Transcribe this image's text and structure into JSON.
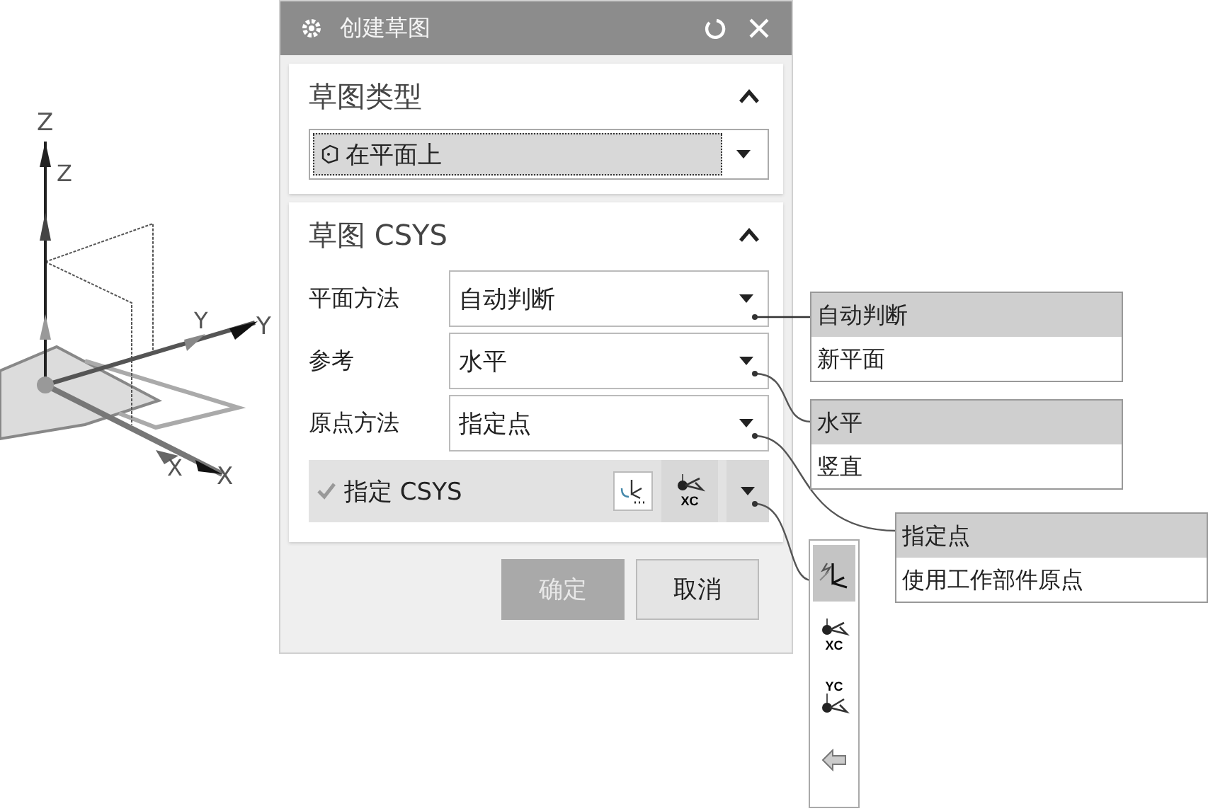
{
  "axes_drawing": {
    "labels": [
      {
        "text": "Z"
      },
      {
        "text": "Z"
      },
      {
        "text": "Y"
      },
      {
        "text": "Y"
      },
      {
        "text": "X"
      },
      {
        "text": "X"
      }
    ]
  },
  "dialog": {
    "title": "创建草图",
    "sketch_type": {
      "title": "草图类型",
      "expanded": true,
      "value": "在平面上"
    },
    "sketch_csys": {
      "title": "草图 CSYS",
      "expanded": true,
      "fields": [
        {
          "label": "平面方法",
          "value": "自动判断"
        },
        {
          "label": "参考",
          "value": "水平"
        },
        {
          "label": "原点方法",
          "value": "指定点"
        }
      ],
      "specify": {
        "label": "指定 CSYS",
        "done": true,
        "icon_label": "XC"
      }
    },
    "buttons": [
      {
        "label": "确定",
        "disabled": true
      },
      {
        "label": "取消",
        "disabled": false
      }
    ]
  },
  "option_lists": [
    {
      "options": [
        {
          "label": "自动判断",
          "selected": true
        },
        {
          "label": "新平面",
          "selected": false
        }
      ]
    },
    {
      "options": [
        {
          "label": "水平",
          "selected": true
        },
        {
          "label": "竖直",
          "selected": false
        }
      ]
    },
    {
      "options": [
        {
          "label": "指定点",
          "selected": true
        },
        {
          "label": "使用工作部件原点",
          "selected": false
        }
      ]
    }
  ],
  "icon_palette": {
    "items": [
      {
        "kind": "csys",
        "selected": true
      },
      {
        "kind": "point_xc",
        "label": "XC",
        "selected": false
      },
      {
        "kind": "point_yc",
        "label": "YC",
        "selected": false
      },
      {
        "kind": "back",
        "selected": false
      }
    ]
  }
}
